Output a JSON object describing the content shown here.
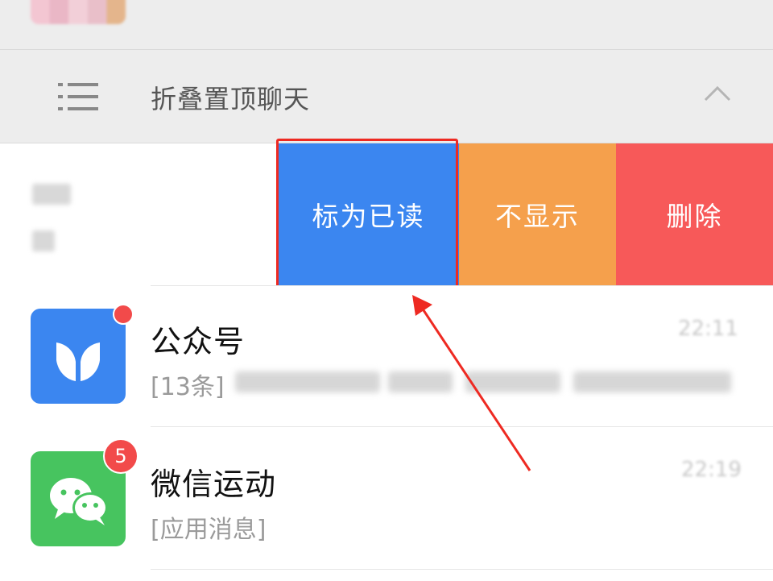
{
  "folded_header": {
    "title": "折叠置顶聊天"
  },
  "swipe_actions": {
    "mark_read": "标为已读",
    "hide": "不显示",
    "delete": "删除"
  },
  "chats": [
    {
      "name": "公众号",
      "preview_prefix": "[13条]",
      "time": "22:11",
      "badge": "dot",
      "icon": "official-accounts-icon"
    },
    {
      "name": "微信运动",
      "preview": "[应用消息]",
      "time": "22:19",
      "badge": "5",
      "icon": "wechat-sport-icon"
    }
  ],
  "colors": {
    "mark_read": "#3b86f0",
    "hide": "#f5a04c",
    "delete": "#f75959",
    "annotation": "#ee2a22"
  }
}
